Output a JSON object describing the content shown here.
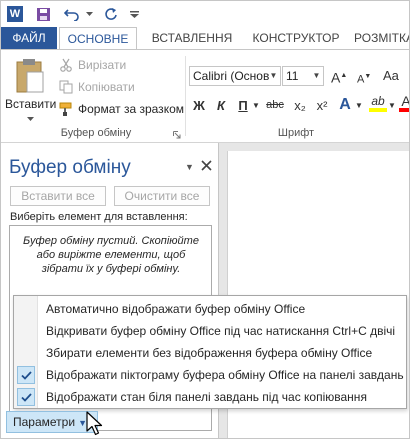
{
  "app": {
    "logo_letter": "W",
    "brand_color": "#2b579a"
  },
  "tabs": [
    "ФАЙЛ",
    "ОСНОВНЕ",
    "ВСТАВЛЕННЯ",
    "КОНСТРУКТОР",
    "РОЗМІТКА"
  ],
  "ribbon": {
    "clipboard": {
      "paste_label": "Вставити",
      "cut_label": "Вирізати",
      "copy_label": "Копіювати",
      "format_painter_label": "Формат за зразком",
      "group_label": "Буфер обміну"
    },
    "font": {
      "font_name": "Calibri (Основ",
      "font_size": "11",
      "bold": "Ж",
      "italic": "К",
      "underline": "П",
      "strike": "abc",
      "subscript": "x₂",
      "superscript": "x²",
      "text_effects": "A",
      "highlight": "ab",
      "font_color": "A",
      "group_label": "Шрифт"
    }
  },
  "pane": {
    "title": "Буфер обміну",
    "paste_all_label": "Вставити все",
    "clear_all_label": "Очистити все",
    "instruction": "Виберіть елемент для вставлення:",
    "empty_message": "Буфер обміну пустий. Скопіюйте або виріжте елементи, щоб зібрати їх у буфері обміну.",
    "options_label": "Параметри"
  },
  "options_menu": [
    {
      "label": "Автоматично відображати буфер обміну Office",
      "checked": false
    },
    {
      "label": "Відкривати буфер обміну Office під час натискання Ctrl+C двічі",
      "checked": false
    },
    {
      "label": "Збирати елементи без відображення буфера обміну Office",
      "checked": false
    },
    {
      "label": "Відображати піктограму буфера обміну Office на панелі завдань",
      "checked": true
    },
    {
      "label": "Відображати стан біля панелі завдань під час копіювання",
      "checked": true
    }
  ]
}
